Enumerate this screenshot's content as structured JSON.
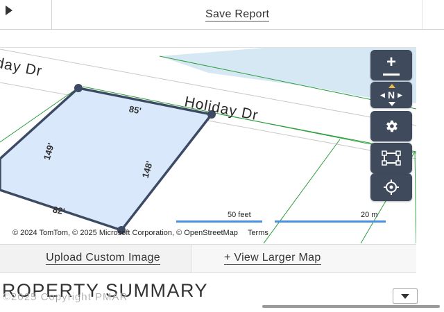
{
  "header": {
    "save_label": "Save Report"
  },
  "map": {
    "road_label_top": "day Dr",
    "road_label_main": "Holiday Dr",
    "dimensions": {
      "top": "85'",
      "left": "149'",
      "right": "148'",
      "bottom": "82'"
    },
    "controls": {
      "zoom_in_icon": "plus-icon",
      "zoom_out_icon": "minus-icon",
      "compass_label": "N",
      "settings_icon": "gear-icon",
      "select_icon": "select-area-icon",
      "locate_icon": "crosshair-icon"
    },
    "scale_feet": "50 feet",
    "scale_meters": "20 m",
    "attribution": "© 2024 TomTom, © 2025 Microsoft Corporation, © OpenStreetMap",
    "terms": "Terms",
    "parcel_fill": "#d9e8fb",
    "parcel_stroke": "#3d4a63",
    "lot_line_color": "#2e9e3e",
    "water_color": "#d6e8f3",
    "scale_color": "#4a90e2"
  },
  "actions": {
    "upload_label": "Upload Custom Image",
    "larger_map_label": "+ View Larger Map"
  },
  "section": {
    "title": "PROPERTY SUMMARY"
  },
  "watermark": "©2025 Copyright PMAR"
}
